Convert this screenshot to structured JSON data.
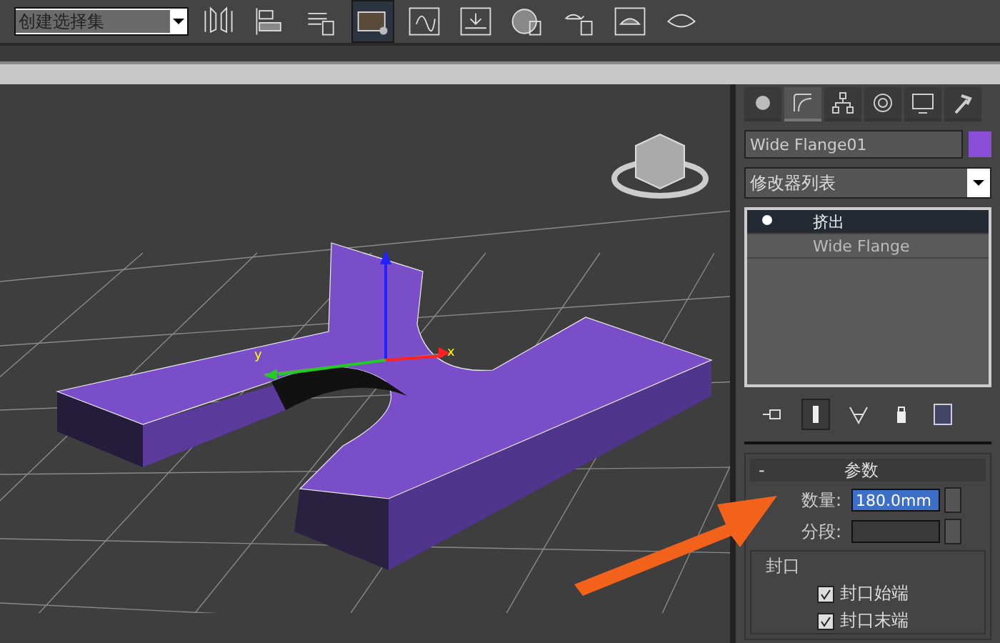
{
  "toolbar": {
    "selection_set": {
      "value": "创建选择集"
    },
    "tools": [
      {
        "selected": false
      },
      {
        "selected": false
      },
      {
        "selected": false
      },
      {
        "selected": true
      },
      {
        "selected": false
      },
      {
        "selected": false
      },
      {
        "selected": false
      },
      {
        "selected": false
      },
      {
        "selected": false
      },
      {
        "selected": false
      }
    ]
  },
  "viewport": {
    "axis_labels": [
      "y",
      "x"
    ]
  },
  "command_panel": {
    "tabs": [
      {
        "selected": false
      },
      {
        "selected": true
      },
      {
        "selected": false
      },
      {
        "selected": false
      },
      {
        "selected": false
      },
      {
        "selected": false
      }
    ],
    "object_name": {
      "value": "Wide Flange01"
    },
    "modifier_list": {
      "value": "修改器列表"
    },
    "modifier_stack": [
      {
        "label": "挤出",
        "selected": true
      },
      {
        "label": "Wide Flange",
        "selected": false
      }
    ],
    "stack_tools": [
      {
        "selected": false
      },
      {
        "selected": true
      },
      {
        "selected": false
      },
      {
        "selected": false
      },
      {
        "selected": false
      }
    ],
    "rollout": {
      "collapse": "-",
      "title": "参数",
      "fields": [
        {
          "label": "数量:",
          "value": "180.0mm"
        },
        {
          "label": "分段:"
        }
      ]
    },
    "capping": {
      "title": "封口",
      "options": [
        {
          "label": "封口始端",
          "checked": true
        },
        {
          "label": "封口末端",
          "checked": true
        }
      ]
    }
  }
}
